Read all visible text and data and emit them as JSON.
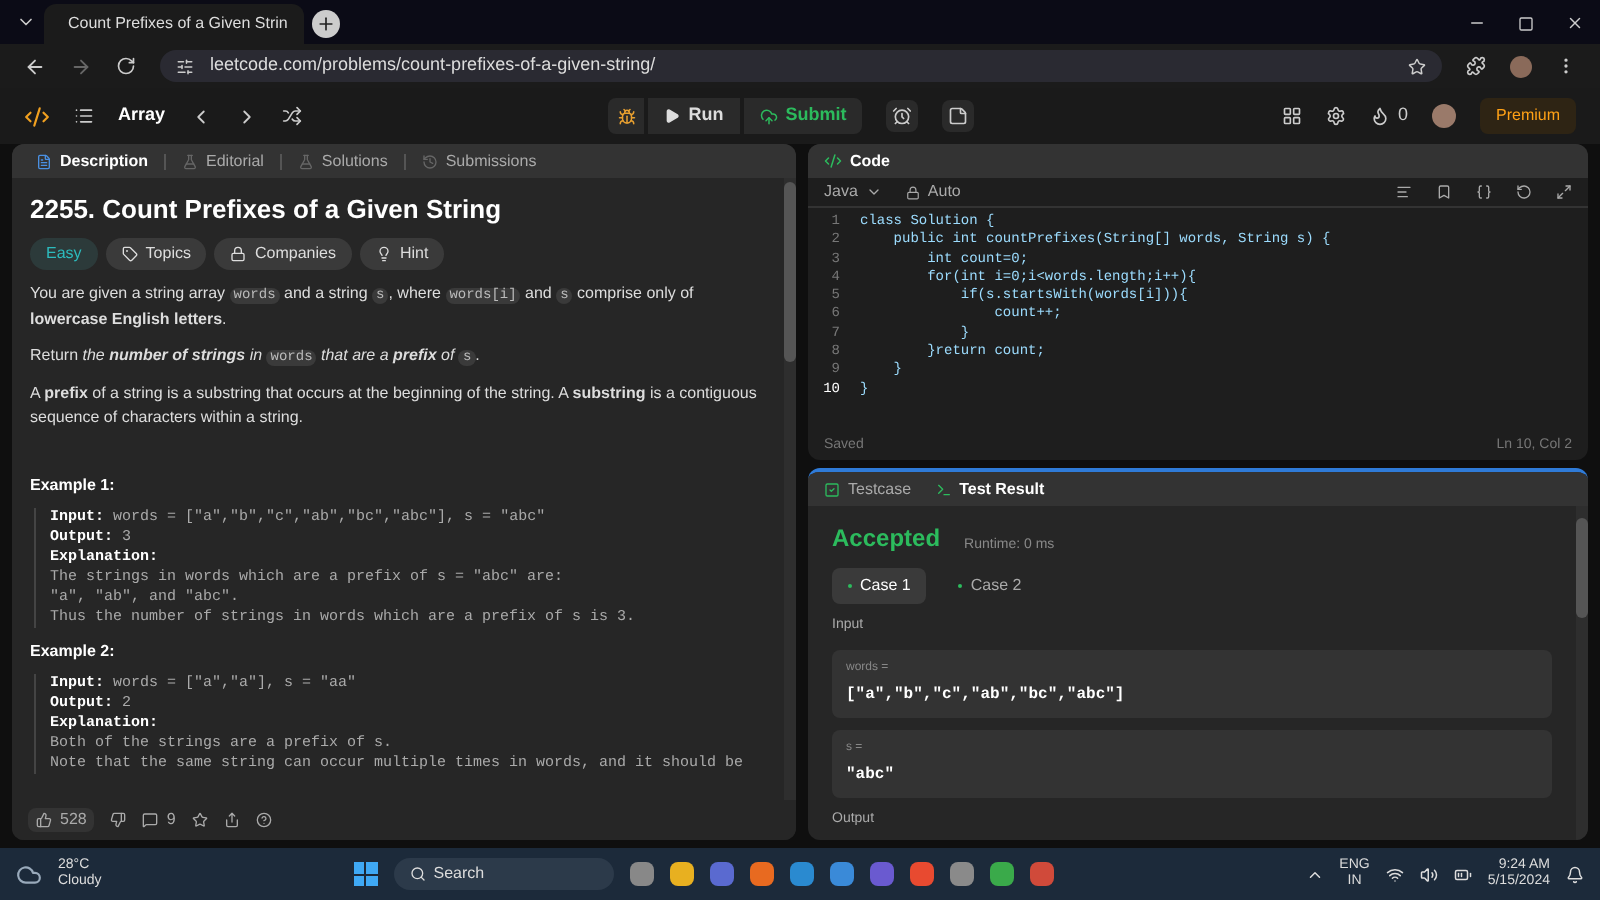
{
  "browser": {
    "tab_title": "Count Prefixes of a Given Strin",
    "url": "leetcode.com/problems/count-prefixes-of-a-given-string/"
  },
  "nav": {
    "list_label": "Array",
    "run": "Run",
    "submit": "Submit",
    "streak": "0",
    "premium": "Premium"
  },
  "left_panel": {
    "tabs": [
      {
        "label": "Description",
        "selected": true
      },
      {
        "label": "Editorial",
        "selected": false
      },
      {
        "label": "Solutions",
        "selected": false
      },
      {
        "label": "Submissions",
        "selected": false
      }
    ],
    "title": "2255. Count Prefixes of a Given String",
    "tags": [
      {
        "label": "Easy",
        "kind": "difficulty"
      },
      {
        "label": "Topics",
        "kind": "topics"
      },
      {
        "label": "Companies",
        "kind": "companies"
      },
      {
        "label": "Hint",
        "kind": "hint"
      }
    ],
    "paragraphs": [
      [
        {
          "kind": "text",
          "text": "You are given a string array "
        },
        {
          "kind": "code",
          "text": "words"
        },
        {
          "kind": "text",
          "text": " and a string "
        },
        {
          "kind": "code",
          "text": "s"
        },
        {
          "kind": "text",
          "text": ", where "
        },
        {
          "kind": "code",
          "text": "words[i]"
        },
        {
          "kind": "text",
          "text": " and "
        },
        {
          "kind": "code",
          "text": "s"
        },
        {
          "kind": "text",
          "text": " comprise only of **lowercase English letters**."
        }
      ],
      [
        {
          "kind": "text",
          "text": "Return "
        },
        {
          "kind": "italic",
          "text": "the **number of strings** in "
        },
        {
          "kind": "code",
          "text": "words"
        },
        {
          "kind": "italic",
          "text": " that are a **prefix** of "
        },
        {
          "kind": "code",
          "text": "s"
        },
        {
          "kind": "text",
          "text": "."
        }
      ],
      [
        {
          "kind": "text",
          "text": "A **prefix** of a string is a substring that occurs at the beginning of the string. A **substring** is a contiguous sequence of characters within a string."
        }
      ]
    ],
    "examples": [
      {
        "heading": "Example 1:",
        "lines": [
          {
            "label": "Input:",
            "text": "words = [\"a\",\"b\",\"c\",\"ab\",\"bc\",\"abc\"], s = \"abc\""
          },
          {
            "label": "Output:",
            "text": "3"
          },
          {
            "label": "Explanation:"
          },
          {
            "text": "The strings in words which are a prefix of s = \"abc\" are:"
          },
          {
            "text": "\"a\", \"ab\", and \"abc\"."
          },
          {
            "text": "Thus the number of strings in words which are a prefix of s is 3."
          }
        ]
      },
      {
        "heading": "Example 2:",
        "lines": [
          {
            "label": "Input:",
            "text": "words = [\"a\",\"a\"], s = \"aa\""
          },
          {
            "label": "Output:",
            "text": "2"
          },
          {
            "label": "Explanation:"
          },
          {
            "text": "Both of the strings are a prefix of s."
          },
          {
            "text": "Note that the same string can occur multiple times in words, and it should be"
          }
        ]
      }
    ],
    "footer": {
      "likes": "528",
      "comments": "9"
    }
  },
  "code_panel": {
    "title": "Code",
    "language": "Java",
    "mode": "Auto",
    "lines": [
      {
        "number": "1",
        "text": "class Solution {"
      },
      {
        "number": "2",
        "text": "    public int countPrefixes(String[] words, String s) {"
      },
      {
        "number": "3",
        "text": "        int count=0;"
      },
      {
        "number": "4",
        "text": "        for(int i=0;i<words.length;i++){"
      },
      {
        "number": "5",
        "text": "            if(s.startsWith(words[i])){"
      },
      {
        "number": "6",
        "text": "                count++;"
      },
      {
        "number": "7",
        "text": "            }"
      },
      {
        "number": "8",
        "text": "        }return count;"
      },
      {
        "number": "9",
        "text": "    }"
      },
      {
        "number": "10",
        "text": "}"
      }
    ],
    "status": "Saved",
    "cursor": "Ln 10, Col 2"
  },
  "test_panel": {
    "tabs": [
      {
        "label": "Testcase",
        "selected": false
      },
      {
        "label": "Test Result",
        "selected": true
      }
    ],
    "verdict": "Accepted",
    "runtime": "Runtime: 0 ms",
    "cases": [
      {
        "label": "Case 1",
        "selected": true
      },
      {
        "label": "Case 2",
        "selected": false
      }
    ],
    "input_label": "Input",
    "inputs": [
      {
        "name": "words =",
        "value": "[\"a\",\"b\",\"c\",\"ab\",\"bc\",\"abc\"]"
      },
      {
        "name": "s =",
        "value": "\"abc\""
      }
    ],
    "output_label": "Output"
  },
  "taskbar": {
    "temperature": "28°C",
    "weather": "Cloudy",
    "search": "Search",
    "lang": "ENG",
    "region": "IN",
    "time": "9:24 AM",
    "date": "5/15/2024"
  }
}
